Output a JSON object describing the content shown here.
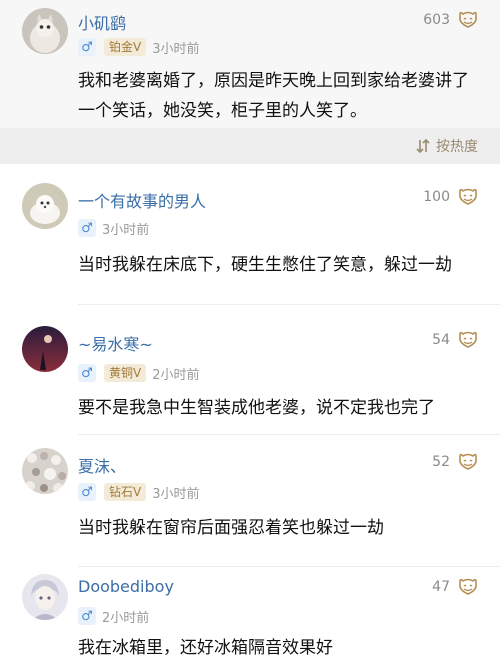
{
  "post": {
    "author": "小矶鹞",
    "gender_symbol": "♂",
    "badge": "铂金V",
    "time": "3小时前",
    "likes": "603",
    "text": "我和老婆离婚了，原因是昨天晚上回到家给老婆讲了一个笑话，她没笑，柜子里的人笑了。",
    "like_icon": "laugh-icon"
  },
  "sort": {
    "label": "按热度",
    "icon": "sort-icon"
  },
  "comments": [
    {
      "author": "一个有故事的男人",
      "gender_symbol": "♂",
      "badge": "",
      "time": "3小时前",
      "likes": "100",
      "text": "当时我躲在床底下，硬生生憋住了笑意，躲过一劫"
    },
    {
      "author": "~易水寒~",
      "gender_symbol": "♂",
      "badge": "黄铜V",
      "time": "2小时前",
      "likes": "54",
      "text": "要不是我急中生智装成他老婆，说不定我也完了"
    },
    {
      "author": "夏沫、",
      "gender_symbol": "♂",
      "badge": "钻石V",
      "time": "3小时前",
      "likes": "52",
      "text": "当时我躲在窗帘后面强忍着笑也躲过一劫"
    },
    {
      "author": "Doobediboy",
      "gender_symbol": "♂",
      "badge": "",
      "time": "2小时前",
      "likes": "47",
      "text": "我在冰箱里，还好冰箱隔音效果好"
    }
  ]
}
